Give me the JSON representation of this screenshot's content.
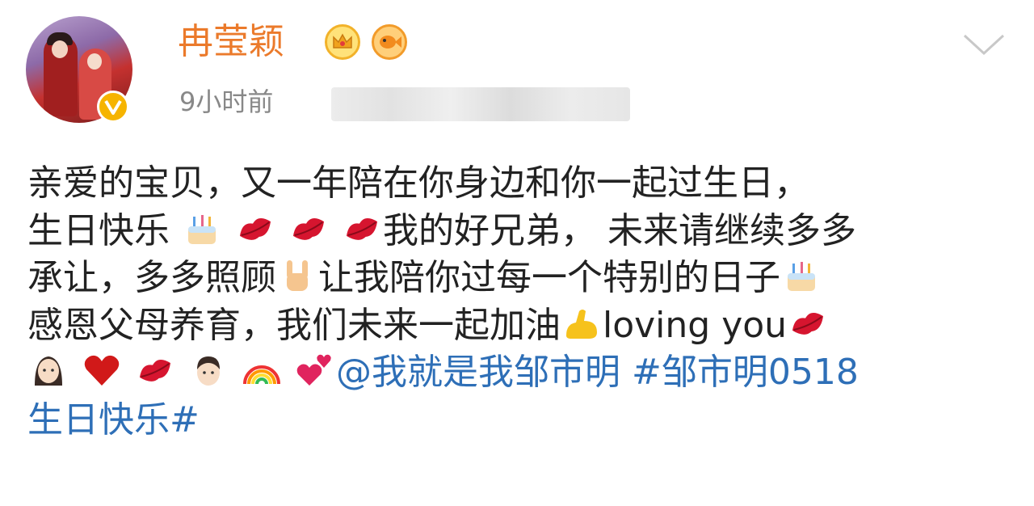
{
  "post": {
    "username": "冉莹颖",
    "time": "9小时前",
    "lines": [
      [
        "亲爱的宝贝，又一年陪在你身边和你一起过生日，"
      ],
      [
        "生日快乐",
        "我的好兄弟， 未来请继续多多"
      ],
      [
        "承让，多多照顾",
        "让我陪你过每一个特别的日子"
      ],
      [
        "感恩父母养育，我们未来一起加油",
        "loving you"
      ],
      [
        "@我就是我邹市明 #邹市明0518"
      ],
      [
        "生日快乐#"
      ]
    ],
    "mention": "@我就是我邹市明",
    "hashtag": "#邹市明0518",
    "hashtag_end": "生日快乐#"
  },
  "colors": {
    "username": "#eb7a2b",
    "link": "#2e6fb7",
    "text": "#222222",
    "meta": "#888888",
    "verify": "#f6b400"
  },
  "icons": [
    "crown-badge-icon",
    "fish-badge-icon",
    "verified-icon",
    "chevron-down-icon",
    "cake-icon",
    "kiss-lips-icon",
    "rock-hand-icon",
    "flexed-biceps-icon",
    "woman-icon",
    "red-heart-icon",
    "man-icon",
    "rainbow-icon",
    "revolving-hearts-icon"
  ]
}
